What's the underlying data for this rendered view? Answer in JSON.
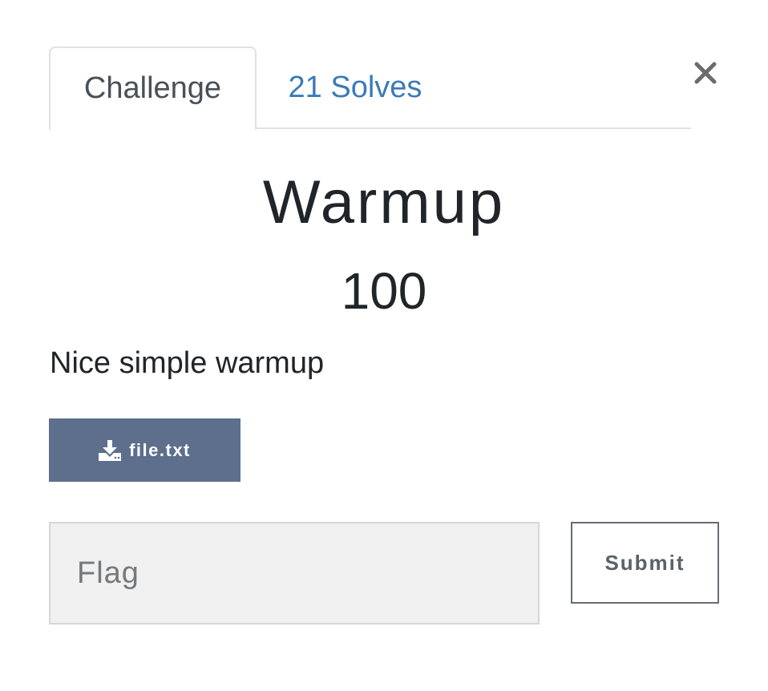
{
  "tabs": [
    {
      "label": "Challenge",
      "active": true
    },
    {
      "label": "21 Solves",
      "active": false
    }
  ],
  "close": {
    "icon": "close-icon",
    "glyph": "×"
  },
  "challenge": {
    "name": "Warmup",
    "points": "100",
    "description": "Nice simple warmup"
  },
  "files": [
    {
      "label": "file.txt",
      "icon": "download-icon"
    }
  ],
  "flag_form": {
    "placeholder": "Flag",
    "value": "",
    "submit_label": "Submit"
  },
  "colors": {
    "tab_link": "#3c7ab7",
    "file_button_bg": "#5d6f8c",
    "input_bg": "#f0f0f0",
    "text": "#212529"
  }
}
